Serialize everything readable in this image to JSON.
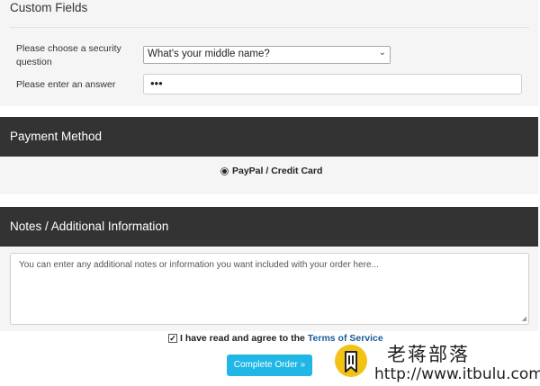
{
  "custom_fields": {
    "title": "Custom Fields",
    "security_label_line1": "Please choose a security",
    "security_label_line2": "question",
    "security_selected": "What's your middle name?",
    "answer_label": "Please enter an answer",
    "answer_value": "•••"
  },
  "payment": {
    "title": "Payment Method",
    "option_label": "PayPal / Credit Card"
  },
  "notes": {
    "title": "Notes / Additional Information",
    "placeholder": "You can enter any additional notes or information you want included with your order here..."
  },
  "agreement": {
    "text": "I have read and agree to the",
    "link": "Terms of Service"
  },
  "submit_label": "Complete Order »",
  "watermark": {
    "title": "老蒋部落",
    "url": "http://www.itbulu.com"
  },
  "colors": {
    "dark_header": "#333333",
    "button": "#20b6e5",
    "link": "#1a5c9a",
    "logo_yellow": "#f2c316"
  }
}
